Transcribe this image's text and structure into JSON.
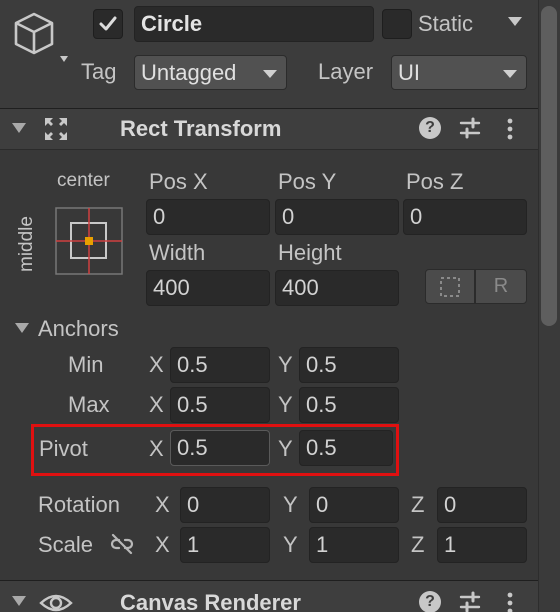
{
  "object": {
    "active_checked": true,
    "name": "Circle",
    "static_checked": false,
    "static_label": "Static",
    "tag_label": "Tag",
    "tag_value": "Untagged",
    "layer_label": "Layer",
    "layer_value": "UI"
  },
  "rect_transform": {
    "title": "Rect Transform",
    "anchor_preset_h": "center",
    "anchor_preset_v": "middle",
    "pos_x_label": "Pos X",
    "pos_y_label": "Pos Y",
    "pos_z_label": "Pos Z",
    "pos_x": "0",
    "pos_y": "0",
    "pos_z": "0",
    "width_label": "Width",
    "height_label": "Height",
    "width": "400",
    "height": "400",
    "raw_edit_label": "R",
    "anchors_label": "Anchors",
    "min_label": "Min",
    "max_label": "Max",
    "x_label": "X",
    "y_label": "Y",
    "z_label": "Z",
    "min_x": "0.5",
    "min_y": "0.5",
    "max_x": "0.5",
    "max_y": "0.5",
    "pivot_label": "Pivot",
    "pivot_x": "0.5",
    "pivot_y": "0.5",
    "rotation_label": "Rotation",
    "rot_x": "0",
    "rot_y": "0",
    "rot_z": "0",
    "scale_label": "Scale",
    "scale_x": "1",
    "scale_y": "1",
    "scale_z": "1"
  },
  "canvas_renderer": {
    "title": "Canvas Renderer"
  },
  "colors": {
    "highlight": "#e01010",
    "anchor_center": "#e8a000",
    "anchor_lines": "#d04040"
  },
  "icons": {
    "gameobject": "cube-icon",
    "rect_transform": "move-arrows-icon",
    "help": "help-icon",
    "presets": "sliders-icon",
    "more": "kebab-menu-icon",
    "visibility": "eye-icon",
    "scale_link": "link-icon"
  }
}
